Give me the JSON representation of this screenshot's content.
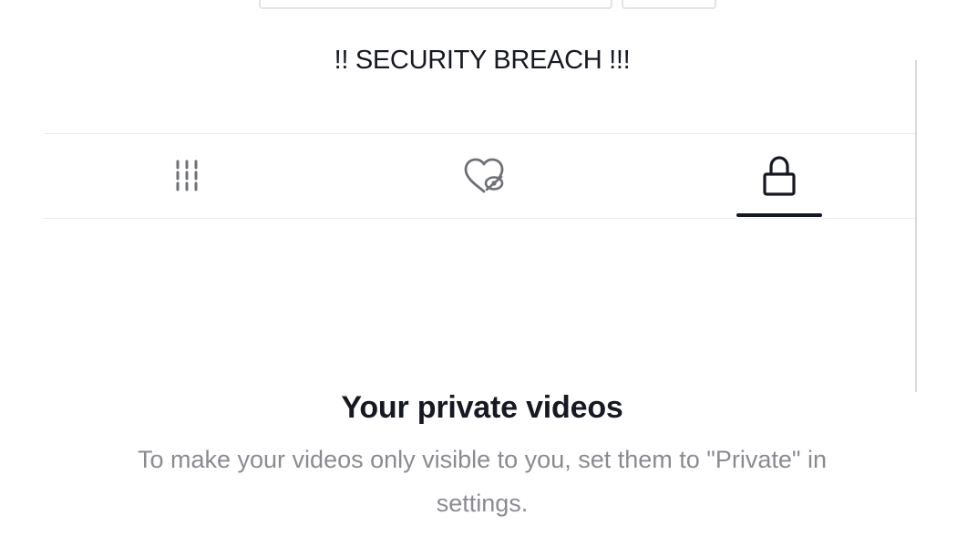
{
  "profile": {
    "bio": "!! SECURITY BREACH !!!"
  },
  "tabs": [
    {
      "name": "videos",
      "icon": "grid-icon",
      "selected": false
    },
    {
      "name": "liked",
      "icon": "liked-hidden-icon",
      "selected": false
    },
    {
      "name": "private",
      "icon": "lock-icon",
      "selected": true
    }
  ],
  "empty_state": {
    "title": "Your private videos",
    "description": "To make your videos only visible to you, set them to \"Private\" in settings."
  },
  "colors": {
    "text_primary": "#161823",
    "text_secondary": "#8a8b91",
    "divider": "#ececed",
    "background": "#ffffff"
  }
}
